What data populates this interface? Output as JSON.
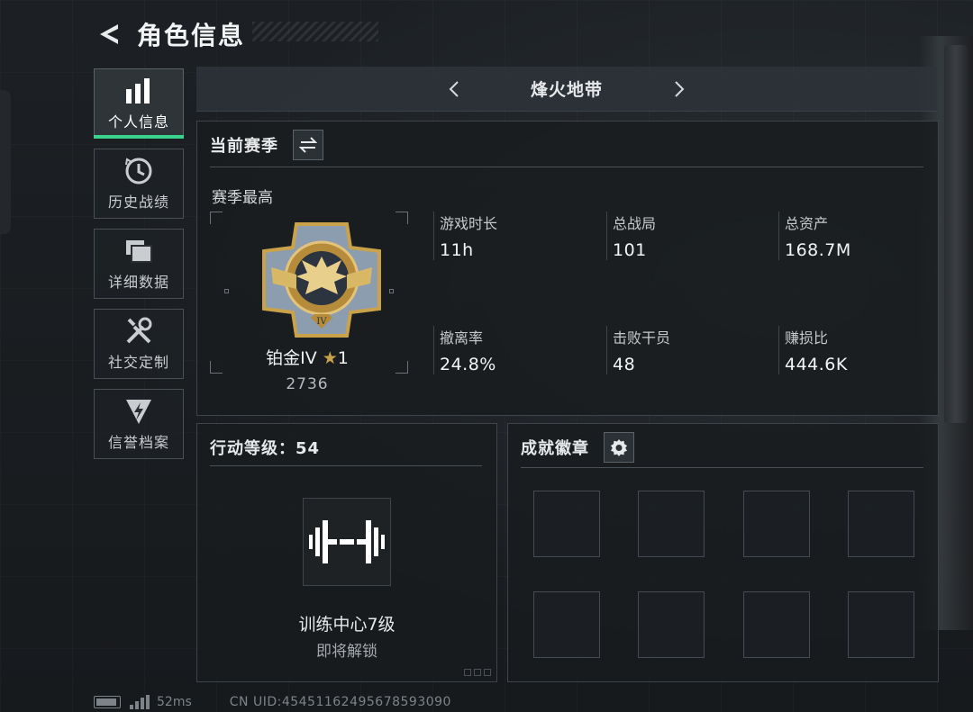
{
  "header": {
    "title": "角色信息"
  },
  "sidebar": {
    "items": [
      {
        "label": "个人信息",
        "icon": "bar-chart-icon",
        "active": true
      },
      {
        "label": "历史战绩",
        "icon": "history-icon"
      },
      {
        "label": "详细数据",
        "icon": "folders-icon"
      },
      {
        "label": "社交定制",
        "icon": "tools-icon"
      },
      {
        "label": "信誉档案",
        "icon": "shield-bolt-icon"
      }
    ]
  },
  "mode": {
    "title": "烽火地带"
  },
  "season": {
    "title": "当前赛季",
    "best_label": "赛季最高",
    "rank_name": "铂金IV",
    "rank_stars": "1",
    "rank_score": "2736",
    "stats": [
      {
        "label": "游戏时长",
        "value": "11h"
      },
      {
        "label": "总战局",
        "value": "101"
      },
      {
        "label": "总资产",
        "value": "168.7M"
      },
      {
        "label": "撤离率",
        "value": "24.8%"
      },
      {
        "label": "击败干员",
        "value": "48"
      },
      {
        "label": "赚损比",
        "value": "444.6K"
      }
    ]
  },
  "level": {
    "title": "行动等级：54",
    "unlock_name": "训练中心7级",
    "unlock_status": "即将解锁"
  },
  "badges": {
    "title": "成就徽章"
  },
  "footer": {
    "ping": "52ms",
    "uid": "CN UID:45451162495678593090"
  },
  "colors": {
    "accent": "#3ad38d",
    "medal_gold": "#c9a24a",
    "medal_blue": "#7f93a8"
  }
}
